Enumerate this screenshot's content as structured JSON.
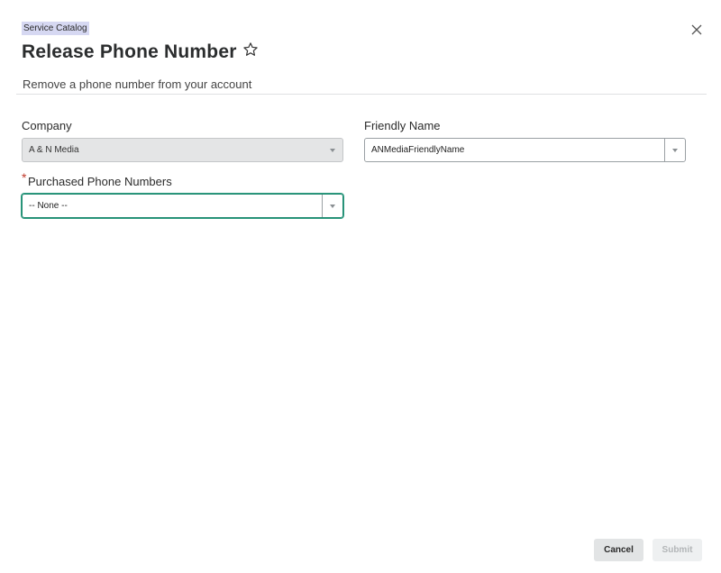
{
  "breadcrumb": "Service Catalog",
  "title": "Release Phone Number",
  "subtitle": "Remove a phone number from your account",
  "fields": {
    "company": {
      "label": "Company",
      "value": "A & N Media",
      "disabled": true
    },
    "friendly_name": {
      "label": "Friendly Name",
      "value": "ANMediaFriendlyName"
    },
    "purchased_numbers": {
      "label": "Purchased Phone Numbers",
      "value": "-- None --",
      "required_mark": "*"
    }
  },
  "buttons": {
    "cancel": "Cancel",
    "submit": "Submit"
  },
  "icons": {
    "close": "close-icon",
    "favorite": "star-outline-icon",
    "dropdown": "chevron-down-icon"
  },
  "colors": {
    "breadcrumb_bg": "#d6d8f2",
    "focus_border": "#1f8a70",
    "required": "#c0392b",
    "disabled_bg": "#e4e5e6"
  }
}
